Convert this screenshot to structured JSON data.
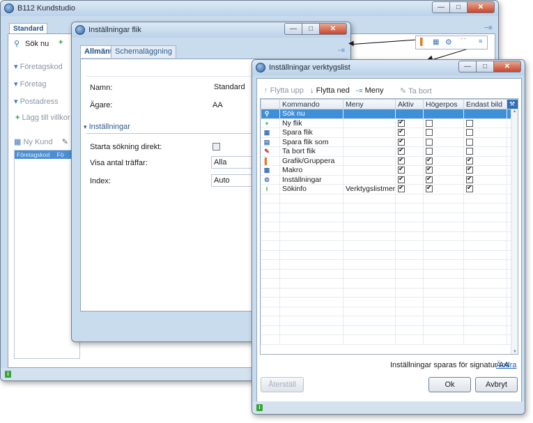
{
  "main_window": {
    "title": "B112 Kundstudio",
    "tab": "Standard",
    "search_btn": "Sök nu",
    "sidebar": [
      "Företagskod",
      "Företag",
      "Postadress"
    ],
    "add_condition": "Lägg till villkor",
    "new_customer": "Ny Kund",
    "grid_header": "Företagskod",
    "grid_header2": "Fö",
    "top_right_icon": "pin-icon"
  },
  "flik_dialog": {
    "title": "Inställningar flik",
    "tabs": [
      "Allmänt",
      "Schemaläggning"
    ],
    "name_label": "Namn:",
    "name_value": "Standard",
    "owner_label": "Ägare:",
    "owner_value": "AA",
    "section": "Inställningar",
    "start_search_label": "Starta sökning direkt:",
    "hits_label": "Visa antal träffar:",
    "hits_value": "Alla",
    "index_label": "Index:",
    "index_value": "Auto"
  },
  "toolbar_dialog": {
    "title": "Inställningar verktygslist",
    "toolbar": {
      "move_up": "Flytta upp",
      "move_down": "Flytta ned",
      "menu": "Meny",
      "delete": "Ta bort"
    },
    "columns": [
      "Kommando",
      "Meny",
      "Aktiv",
      "Högerpos",
      "Endast bild"
    ],
    "rows": [
      {
        "icon": "search-icon",
        "command": "Sök nu",
        "menu": "",
        "active": false,
        "right": false,
        "image_only": false,
        "selected": true
      },
      {
        "icon": "plus-icon",
        "command": "Ny flik",
        "menu": "",
        "active": true,
        "right": false,
        "image_only": false
      },
      {
        "icon": "save-icon",
        "command": "Spara flik",
        "menu": "",
        "active": true,
        "right": false,
        "image_only": false
      },
      {
        "icon": "save-as-icon",
        "command": "Spara flik som",
        "menu": "",
        "active": true,
        "right": false,
        "image_only": false
      },
      {
        "icon": "delete-tab-icon",
        "command": "Ta bort flik",
        "menu": "",
        "active": true,
        "right": false,
        "image_only": false
      },
      {
        "icon": "chart-icon",
        "command": "Grafik/Gruppera",
        "menu": "",
        "active": true,
        "right": true,
        "image_only": true
      },
      {
        "icon": "macro-icon",
        "command": "Makro",
        "menu": "",
        "active": true,
        "right": true,
        "image_only": true
      },
      {
        "icon": "gear-icon",
        "command": "Inställningar",
        "menu": "",
        "active": true,
        "right": true,
        "image_only": true
      },
      {
        "icon": "info-icon",
        "command": "Sökinfo",
        "menu": "Verktygslistmeny",
        "active": true,
        "right": true,
        "image_only": true
      }
    ],
    "footer_text": "Inställningar sparas för signatur AA",
    "change_link": "Ändra",
    "reset_btn": "Återställ",
    "ok_btn": "Ok",
    "cancel_btn": "Avbryt"
  }
}
